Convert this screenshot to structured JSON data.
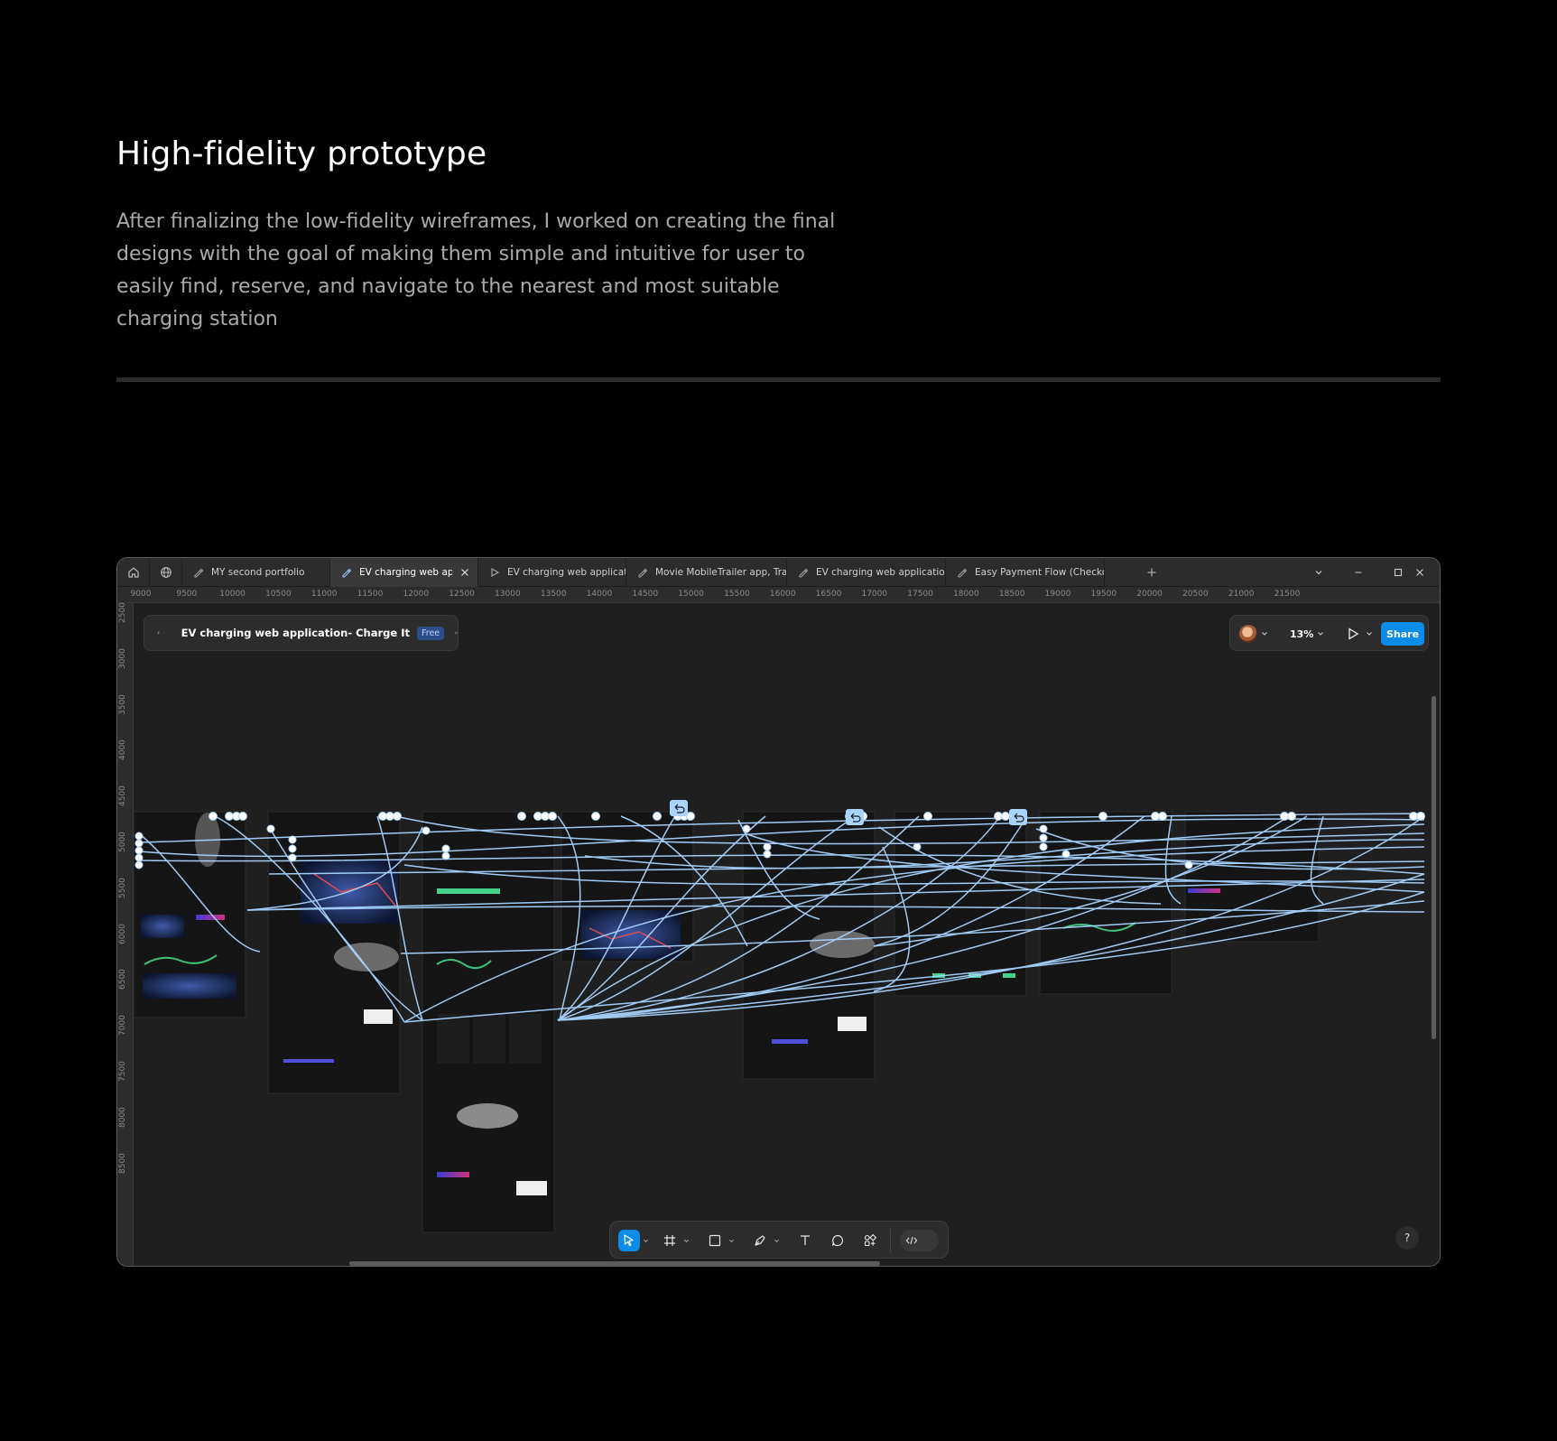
{
  "section": {
    "title": "High-fidelity prototype",
    "description": "After finalizing the low-fidelity wireframes, I worked on creating the final designs with the goal of making them simple and intuitive for user to easily find, reserve, and navigate to the nearest and most suitable charging station"
  },
  "window": {
    "tabs": [
      {
        "label": "MY second portfolio",
        "icon": "design-file-icon"
      },
      {
        "label": "EV charging web application- Charge It",
        "icon": "design-file-icon",
        "active": true
      },
      {
        "label": "EV charging web application",
        "icon": "prototype-play-icon"
      },
      {
        "label": "Movie MobileTrailer app, Trailer",
        "icon": "design-file-icon"
      },
      {
        "label": "EV charging web application",
        "icon": "design-file-icon"
      },
      {
        "label": "Easy Payment  Flow (Checkout)",
        "icon": "design-file-icon"
      }
    ],
    "ruler_x": [
      "9000",
      "9500",
      "10000",
      "10500",
      "11000",
      "11500",
      "12000",
      "12500",
      "13000",
      "13500",
      "14000",
      "14500",
      "15000",
      "15500",
      "16000",
      "16500",
      "17000",
      "17500",
      "18000",
      "18500",
      "19000",
      "19500",
      "20000",
      "20500",
      "21000",
      "21500"
    ],
    "ruler_y": [
      "2500",
      "3000",
      "3500",
      "4000",
      "4500",
      "5000",
      "5500",
      "6000",
      "6500",
      "7000",
      "7500",
      "8000",
      "8500"
    ],
    "file_panel": {
      "file_name": "EV charging web application- Charge It",
      "plan_badge": "Free"
    },
    "right_panel": {
      "zoom": "13%",
      "share_label": "Share"
    },
    "help_label": "?",
    "colors": {
      "accent": "#0c8ce9",
      "canvas": "#1f1f1f",
      "chrome": "#2c2c2c",
      "connector": "#a8d4ff"
    }
  }
}
